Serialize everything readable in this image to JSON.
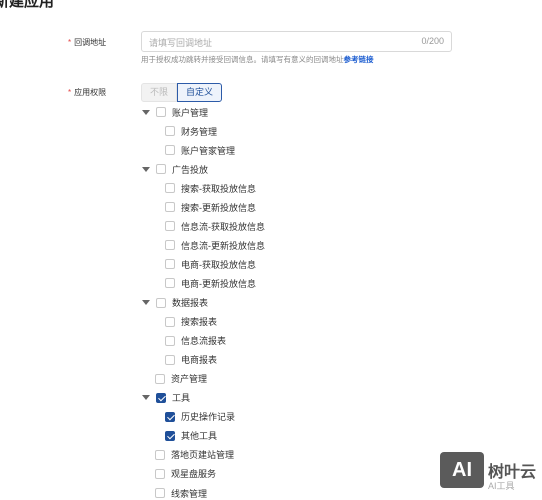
{
  "page": {
    "title": "新建应用"
  },
  "callback": {
    "label": "回调地址",
    "required_mark": "*",
    "placeholder": "请填写回调地址",
    "counter": "0/200",
    "hint": "用于授权成功跳转并接受回调信息。请填写有意义的回调地址",
    "hint_link": "参考链接"
  },
  "permissions": {
    "label": "应用权限",
    "required_mark": "*",
    "toggle": {
      "off_label": "不限",
      "on_label": "自定义",
      "selected": "自定义"
    },
    "tree": [
      {
        "label": "账户管理",
        "expanded": true,
        "checked": false,
        "children": [
          {
            "label": "财务管理",
            "checked": false
          },
          {
            "label": "账户管家管理",
            "checked": false
          }
        ]
      },
      {
        "label": "广告投放",
        "expanded": true,
        "checked": false,
        "children": [
          {
            "label": "搜索-获取投放信息",
            "checked": false
          },
          {
            "label": "搜索-更新投放信息",
            "checked": false
          },
          {
            "label": "信息流-获取投放信息",
            "checked": false
          },
          {
            "label": "信息流-更新投放信息",
            "checked": false
          },
          {
            "label": "电商-获取投放信息",
            "checked": false
          },
          {
            "label": "电商-更新投放信息",
            "checked": false
          }
        ]
      },
      {
        "label": "数据报表",
        "expanded": true,
        "checked": false,
        "children": [
          {
            "label": "搜索报表",
            "checked": false
          },
          {
            "label": "信息流报表",
            "checked": false
          },
          {
            "label": "电商报表",
            "checked": false
          }
        ]
      },
      {
        "label": "资产管理",
        "checked": false
      },
      {
        "label": "工具",
        "expanded": true,
        "checked": true,
        "children": [
          {
            "label": "历史操作记录",
            "checked": true
          },
          {
            "label": "其他工具",
            "checked": true
          }
        ]
      },
      {
        "label": "落地页建站管理",
        "checked": false
      },
      {
        "label": "观星盘服务",
        "checked": false
      },
      {
        "label": "线索管理",
        "checked": false
      }
    ]
  },
  "watermark": {
    "logo": "AI",
    "name": "树叶云",
    "sub": "AI工具"
  },
  "colors": {
    "accent": "#1f4f99",
    "required": "#e54545",
    "link": "#1f5fd1"
  }
}
